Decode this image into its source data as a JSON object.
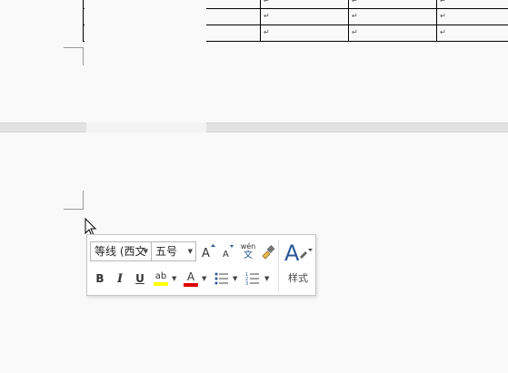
{
  "document": {
    "paragraph_mark": "↵"
  },
  "mini_toolbar": {
    "font_name": "等线 (西文",
    "font_size": "五号",
    "grow_font_glyph": "A",
    "shrink_font_glyph": "A",
    "phonetic_guide_top": "wén",
    "phonetic_guide_bottom": "文",
    "bold_label": "B",
    "italic_label": "I",
    "underline_label": "U",
    "highlight_label": "ab",
    "font_color_label": "A",
    "styles_glyph": "A",
    "styles_label": "样式",
    "colors": {
      "highlight": "#ffff00",
      "font_color": "#e00000",
      "accent": "#2b579a"
    }
  }
}
